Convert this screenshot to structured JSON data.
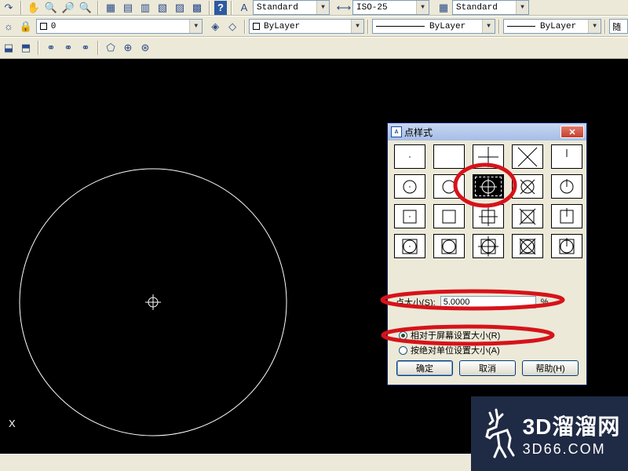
{
  "toolbar_top": {
    "text_style": "Standard",
    "dim_style": "ISO-25",
    "table_style": "Standard"
  },
  "toolbar_layers": {
    "layer_name": "0",
    "color": "ByLayer",
    "linetype": "ByLayer",
    "lineweight": "ByLayer",
    "plot_style": "随"
  },
  "canvas": {
    "ucs_label": "X"
  },
  "dialog": {
    "title": "点样式",
    "app_icon": "A",
    "close": "✕",
    "point_size_label": "点大小(S):",
    "point_size_value": "5.0000",
    "percent": "%",
    "radio_relative": "相对于屏幕设置大小(R)",
    "radio_absolute": "按绝对单位设置大小(A)",
    "ok": "确定",
    "cancel": "取消",
    "help": "帮助(H)",
    "selected_style_index": 7
  },
  "watermark": {
    "main": "3D溜溜网",
    "sub": "3D66.COM"
  },
  "colors": {
    "highlight": "#d6131a",
    "canvas": "#000000",
    "dialog_bg": "#ece9d8"
  }
}
